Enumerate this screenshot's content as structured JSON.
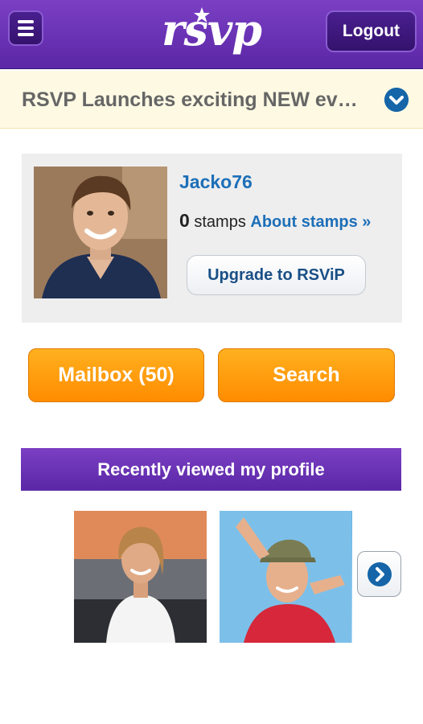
{
  "header": {
    "logo_text": "rsvp",
    "logout_label": "Logout",
    "menu_icon": "hamburger-menu-icon"
  },
  "news": {
    "text": "RSVP Launches exciting NEW ev…",
    "expand_icon": "chevron-down-icon"
  },
  "profile": {
    "username": "Jacko76",
    "stamps_count": "0",
    "stamps_label": "stamps",
    "about_stamps_label": "About stamps »",
    "upgrade_label": "Upgrade to RSViP"
  },
  "actions": {
    "mailbox_label": "Mailbox (50)",
    "search_label": "Search"
  },
  "recent": {
    "header": "Recently viewed my profile",
    "next_icon": "chevron-right-icon"
  },
  "colors": {
    "brand_purple": "#6a31b5",
    "accent_orange": "#ff9a0f",
    "link_blue": "#1d6fb8"
  }
}
